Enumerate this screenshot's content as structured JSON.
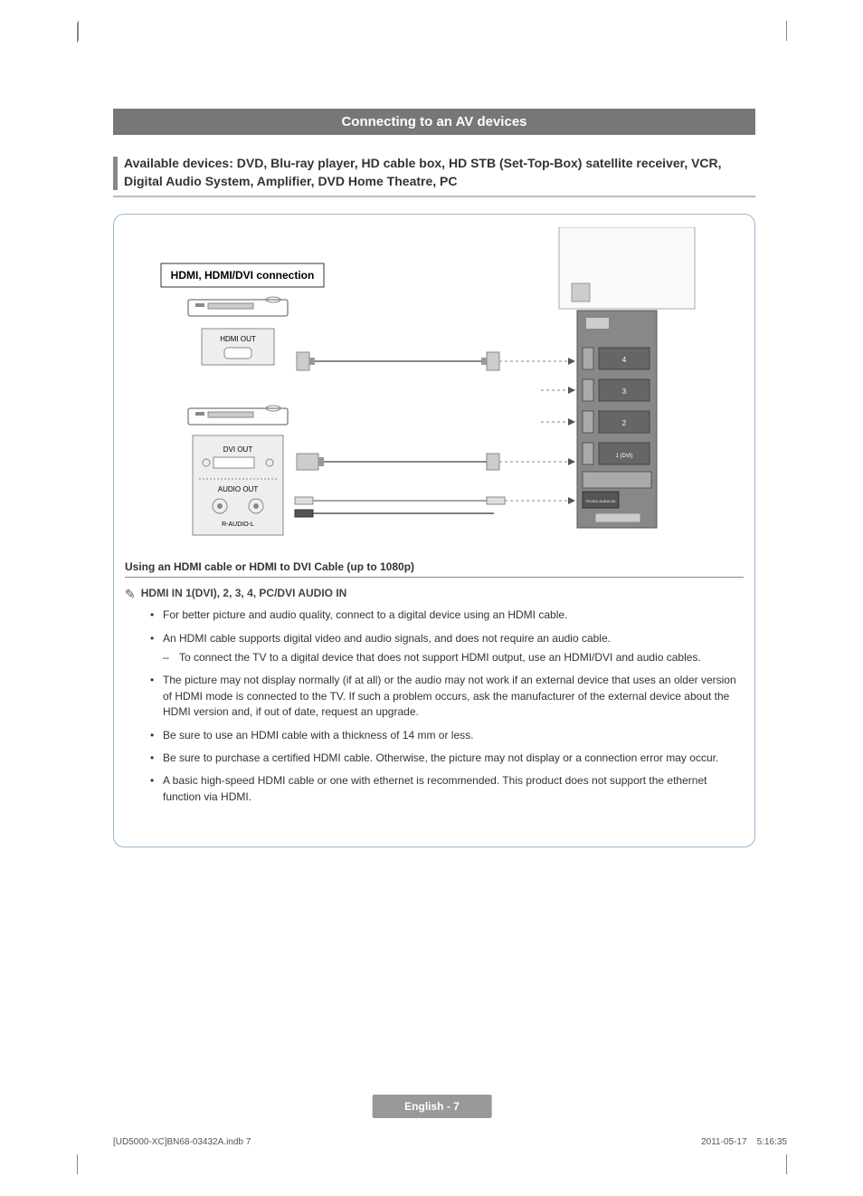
{
  "section_title": "Connecting to an AV devices",
  "devices_intro": "Available devices: DVD, Blu-ray player, HD cable box, HD STB (Set-Top-Box) satellite receiver, VCR, Digital Audio System, Amplifier, DVD Home Theatre, PC",
  "diagram": {
    "conn_label": "HDMI, HDMI/DVI connection",
    "hdmi_out": "HDMI OUT",
    "dvi_out": "DVI OUT",
    "audio_out": "AUDIO OUT",
    "r_audio_l": "R-AUDIO-L",
    "panel": {
      "port4": "4",
      "port3": "3",
      "port2": "2",
      "port1": "1 (DVI)",
      "pc_dvi_audio": "PC/DVI AUDIO IN"
    }
  },
  "subheading": "Using an HDMI cable or HDMI to DVI Cable (up to 1080p)",
  "note_label": "HDMI IN 1(DVI), 2, 3, 4, PC/DVI AUDIO IN",
  "bullets": [
    {
      "text": "For better picture and audio quality, connect to a digital device using an HDMI cable."
    },
    {
      "text": "An HDMI cable supports digital video and audio signals, and does not require an audio cable.",
      "sub": "To connect the TV to a digital device that does not support HDMI output, use an HDMI/DVI and audio cables."
    },
    {
      "text": "The picture may not display normally (if at all) or the audio may not work if an external device that uses an older version of HDMI mode is connected to the TV. If such a problem occurs, ask the manufacturer of the external device about the HDMI version and, if out of date, request an upgrade."
    },
    {
      "text": "Be sure to use an HDMI cable with a thickness of 14 mm or less."
    },
    {
      "text": "Be sure to purchase a certified HDMI cable. Otherwise, the picture may not display or a connection error may occur."
    },
    {
      "text": "A basic high-speed HDMI cable or one with ethernet is recommended. This product does not support the ethernet function via HDMI."
    }
  ],
  "page_footer": "English - 7",
  "print_left": "[UD5000-XC]BN68-03432A.indb   7",
  "print_right": "2011-05-17      5:16:35"
}
